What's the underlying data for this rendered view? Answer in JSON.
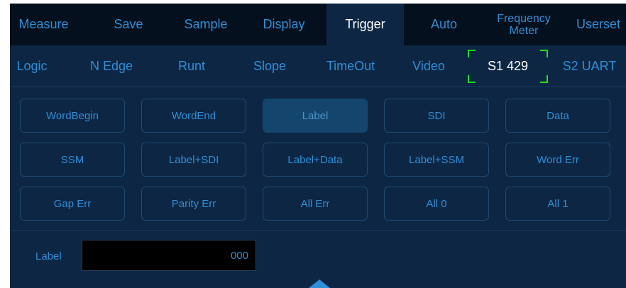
{
  "top_tabs": [
    {
      "label": "Measure"
    },
    {
      "label": "Save"
    },
    {
      "label": "Sample"
    },
    {
      "label": "Display"
    },
    {
      "label": "Trigger",
      "active": true
    },
    {
      "label": "Auto"
    },
    {
      "label": "Frequency\nMeter"
    },
    {
      "label": "Userset"
    }
  ],
  "sub_tabs": [
    {
      "label": "Logic"
    },
    {
      "label": "N Edge"
    },
    {
      "label": "Runt"
    },
    {
      "label": "Slope"
    },
    {
      "label": "TimeOut"
    },
    {
      "label": "Video"
    },
    {
      "label": "S1 429",
      "active": true
    },
    {
      "label": "S2 UART"
    }
  ],
  "options": [
    [
      "WordBegin",
      "WordEnd",
      "Label",
      "SDI",
      "Data"
    ],
    [
      "SSM",
      "Label+SDI",
      "Label+Data",
      "Label+SSM",
      "Word Err"
    ],
    [
      "Gap Err",
      "Parity Err",
      "All Err",
      "All 0",
      "All 1"
    ]
  ],
  "selected_option": "Label",
  "label_field": {
    "caption": "Label",
    "value": "000"
  },
  "colors": {
    "background": "#0c2643",
    "menu_bar": "#04101d",
    "text_accent": "#2f8fd8",
    "active_text": "#ffffff",
    "focus_corners": "#1ee01e",
    "selected_button": "#14466d"
  },
  "icons": {
    "collapse_arrow": "up-triangle-icon"
  }
}
